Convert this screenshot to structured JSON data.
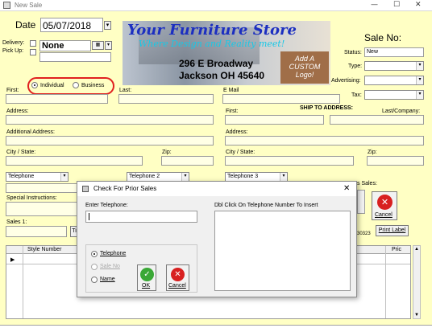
{
  "window": {
    "title": "New Sale",
    "controls": {
      "minimize": "—",
      "maximize": "☐",
      "close": "✕"
    }
  },
  "header": {
    "date_label": "Date",
    "date_value": "05/07/2018",
    "delivery_label": "Delivery:",
    "pickup_label": "Pick Up:",
    "delivery_value": "None",
    "sale_no_label": "Sale No:"
  },
  "ad": {
    "store_name": "Your Furniture Store",
    "tagline": "Where Design and Reality meet!",
    "address_line1": "296 E Broadway",
    "address_line2": "Jackson OH 45640",
    "badge": [
      "Add A",
      "CUSTOM",
      "Logo!"
    ]
  },
  "status": {
    "status_label": "Status:",
    "status_value": "New",
    "type_label": "Type:",
    "advertising_label": "Advertising:",
    "tax_label": "Tax:"
  },
  "customer_type": {
    "individual": "Individual",
    "business": "Business",
    "selected": "individual"
  },
  "fields": {
    "first": "First:",
    "last": "Last:",
    "email": "E Mail",
    "address": "Address:",
    "additional_address": "Additional Address:",
    "city_state": "City / State:",
    "zip": "Zip:",
    "ship_to": "SHIP TO ADDRESS:",
    "ship_first": "First:",
    "ship_last_company": "Last/Company:",
    "ship_address": "Address:",
    "ship_city_state": "City / State:",
    "ship_zip": "Zip:",
    "telephone1": "Telephone",
    "telephone2": "Telephone 2",
    "telephone3": "Telephone 3",
    "special_instructions": "Special Instructions:",
    "sales1": "Sales 1:",
    "sales_partial": "s Sales:",
    "number_partial": "30323",
    "text_partial": "Ti"
  },
  "buttons": {
    "print_label": "Print Label",
    "cancel": "Cancel",
    "ok": "OK"
  },
  "grid": {
    "columns": [
      "Style Number",
      "Pric"
    ]
  },
  "dialog": {
    "title": "Check For Prior Sales",
    "enter_telephone": "Enter Telephone:",
    "dbl_click": "Dbl Click On Telephone Number To Insert",
    "options": [
      "Telephone",
      "Sale No",
      "Name"
    ],
    "selected": "Telephone",
    "close": "✕"
  },
  "colors": {
    "form_bg": "#ffffc4",
    "highlight": "#e02020",
    "ok_green": "#3aa836",
    "cancel_red": "#d82020",
    "ad_blue": "#1c2fc0",
    "ad_cyan": "#18c8e6"
  }
}
